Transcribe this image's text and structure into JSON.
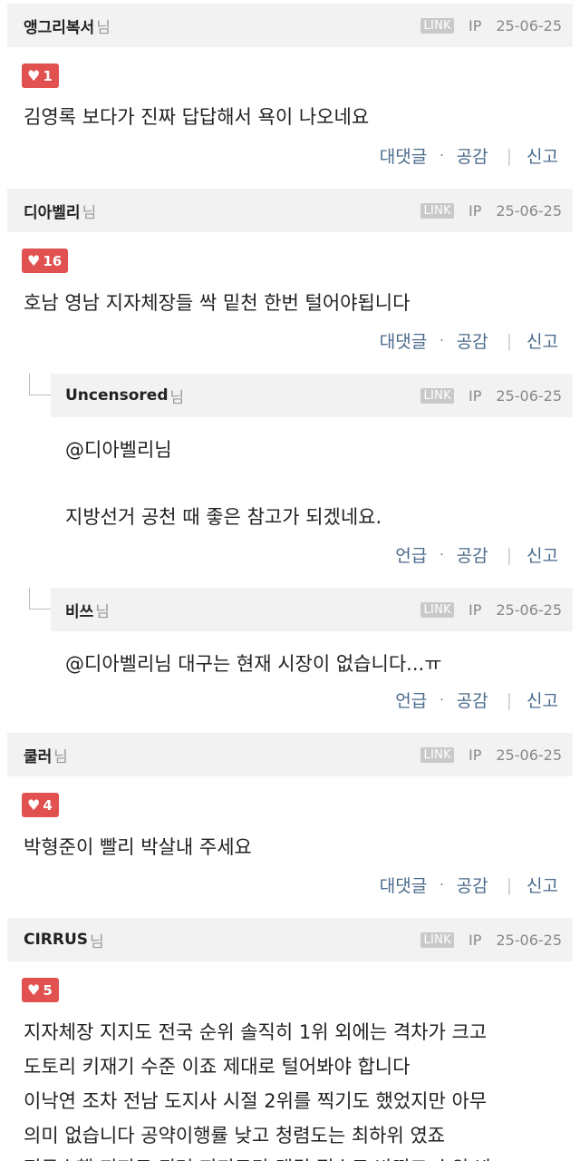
{
  "comments": [
    {
      "nick": "앵그리복서",
      "nim": "님",
      "link": "LINK",
      "ip": "IP",
      "date": "25-06-25",
      "likes": "1",
      "lines": [
        "김영록 보다가 진짜 답답해서 욕이 나오네요"
      ],
      "reply_label": "대댓글",
      "dot": "·",
      "like_label": "공감",
      "sep": "|",
      "report_label": "신고"
    },
    {
      "nick": "디아벨리",
      "nim": "님",
      "link": "LINK",
      "ip": "IP",
      "date": "25-06-25",
      "likes": "16",
      "lines": [
        "호남 영남 지자체장들 싹 밑천 한번 털어야됩니다"
      ],
      "reply_label": "대댓글",
      "dot": "·",
      "like_label": "공감",
      "sep": "|",
      "report_label": "신고"
    },
    {
      "nick": "Uncensored",
      "nim": "님",
      "link": "LINK",
      "ip": "IP",
      "date": "25-06-25",
      "lines": [
        "@디아벨리님",
        "지방선거 공천 때 좋은 참고가 되겠네요."
      ],
      "reply_label": "언급",
      "dot": "·",
      "like_label": "공감",
      "sep": "|",
      "report_label": "신고"
    },
    {
      "nick": "비쓰",
      "nim": "님",
      "link": "LINK",
      "ip": "IP",
      "date": "25-06-25",
      "lines": [
        "@디아벨리님 대구는 현재 시장이 없습니다...ㅠ"
      ],
      "reply_label": "언급",
      "dot": "·",
      "like_label": "공감",
      "sep": "|",
      "report_label": "신고"
    },
    {
      "nick": "쿨러",
      "nim": "님",
      "link": "LINK",
      "ip": "IP",
      "date": "25-06-25",
      "likes": "4",
      "lines": [
        "박형준이 빨리 박살내 주세요"
      ],
      "reply_label": "대댓글",
      "dot": "·",
      "like_label": "공감",
      "sep": "|",
      "report_label": "신고"
    },
    {
      "nick": "CIRRUS",
      "nim": "님",
      "link": "LINK",
      "ip": "IP",
      "date": "25-06-25",
      "likes": "5",
      "lines": [
        "지자체장 지지도 전국 순위 솔직히 1위 외에는 격차가 크고",
        "도토리 키재기 수준 이죠 제대로 털어봐야 합니다",
        "이낙연 조차 전남 도지사 시절 2위를 찍기도 했었지만 아무",
        "의미 없습니다 공약이행률 낮고 청렴도는 최하위 였죠",
        "전무수행 지지도 되려 지지도만 랭킹 점수로 바꿔고 순위 봐"
      ]
    }
  ],
  "icons": {
    "heart": "heart-icon"
  },
  "colors": {
    "like_badge": "#e05150",
    "header_bg": "#f2f2f2",
    "action_text": "#4a6a8a"
  }
}
